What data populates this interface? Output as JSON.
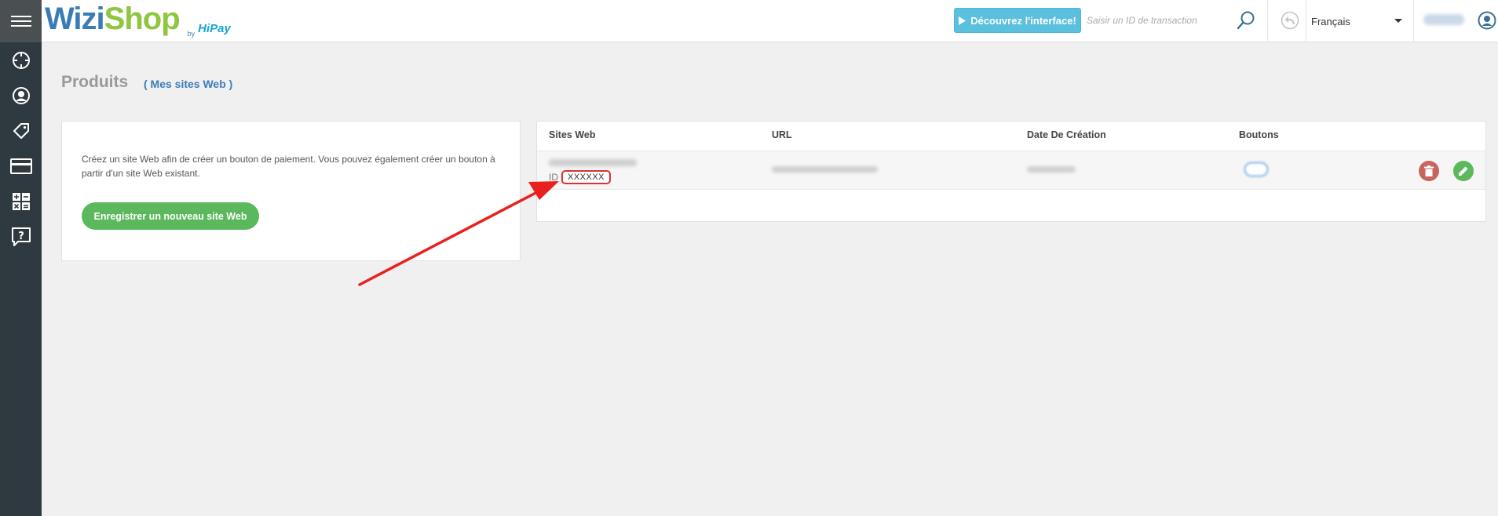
{
  "app": {
    "logo_wizi": "Wizi",
    "logo_shop": "Shop",
    "logo_by": "by",
    "logo_hipay": "HiPay"
  },
  "topbar": {
    "discover_label": "Découvrez l'interface!",
    "search_placeholder": "Saisir un ID de transaction",
    "language": "Français"
  },
  "sidebar": {
    "items": [
      {
        "icon": "menu-icon"
      },
      {
        "icon": "dashboard-icon"
      },
      {
        "icon": "user-icon"
      },
      {
        "icon": "tag-icon"
      },
      {
        "icon": "card-icon"
      },
      {
        "icon": "calculator-icon"
      },
      {
        "icon": "help-icon"
      }
    ]
  },
  "page": {
    "title": "Produits",
    "subtitle": "( Mes sites Web )"
  },
  "info_card": {
    "text": "Créez un site Web afin de créer un bouton de paiement. Vous pouvez également créer un bouton à partir d'un site Web existant.",
    "button_label": "Enregistrer un nouveau site Web"
  },
  "table": {
    "columns": [
      "Sites Web",
      "URL",
      "Date De Création",
      "Boutons"
    ],
    "rows": [
      {
        "id_label": "ID",
        "id_value": "XXXXXX"
      }
    ]
  },
  "colors": {
    "sidebar": "#2f3a40",
    "accent_blue": "#3a7cb5",
    "info_button": "#5bc0de",
    "success": "#5cb85c",
    "danger": "#c9645f",
    "annotation_red": "#e8201e"
  }
}
